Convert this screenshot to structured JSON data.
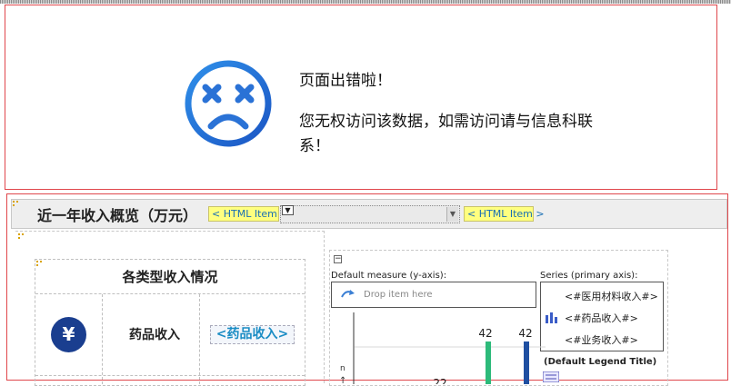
{
  "error": {
    "title": "页面出错啦！",
    "message": "您无权访问该数据，如需访问请与信息科联系！"
  },
  "header": {
    "title": "近一年收入概览（万元）",
    "html_item_1": "< HTML Item >",
    "html_item_2": "< HTML Item >",
    "select_arrow": "▼",
    "select_handle": "▼"
  },
  "income_card": {
    "heading": "各类型收入情况",
    "icon": "yuan-icon",
    "icon_glyph": "¥",
    "label": "药品收入",
    "field": "<药品收入>"
  },
  "chart": {
    "collapse": "−",
    "measure_label": "Default measure (y-axis):",
    "drop_text": "Drop item here",
    "series_label": "Series (primary axis):",
    "series_items": [
      "<#医用材料收入#>",
      "<#药品收入#>",
      "<#业务收入#>"
    ],
    "legend_title": "(Default Legend Title)",
    "colors": {
      "green": "#2dba7a",
      "blue": "#1f4fa1"
    }
  },
  "chart_data": {
    "type": "bar",
    "series": [
      {
        "values": [
          42
        ]
      },
      {
        "values": [
          42
        ]
      }
    ],
    "data_labels": [
      "42",
      "42",
      "22"
    ],
    "ylabel": "n"
  }
}
